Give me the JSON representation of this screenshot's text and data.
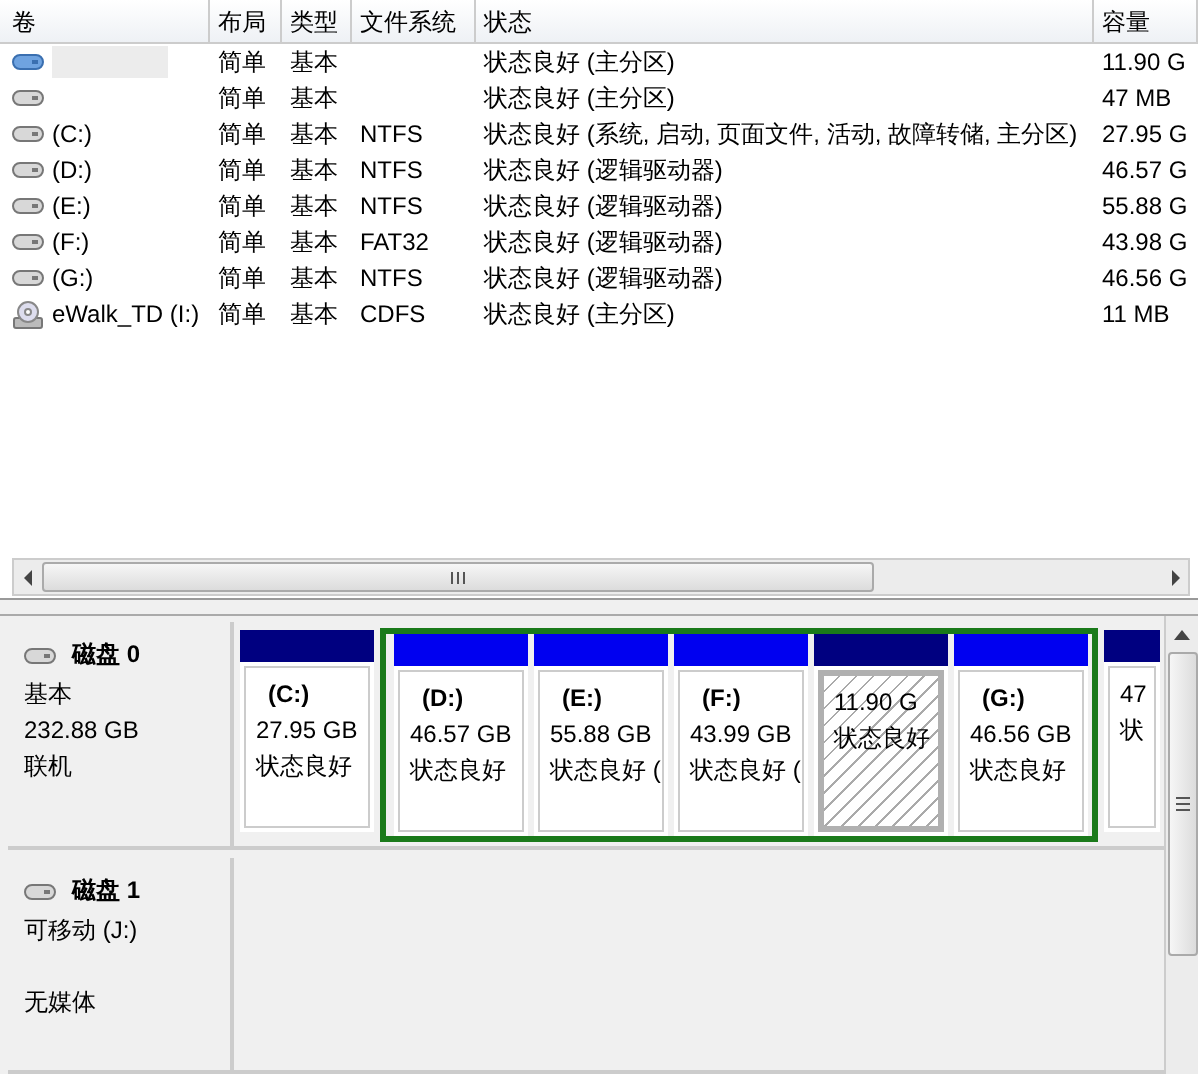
{
  "volume_list": {
    "columns": [
      "卷",
      "布局",
      "类型",
      "文件系统",
      "状态",
      "容量"
    ],
    "rows": [
      {
        "kind": "disk",
        "selected": true,
        "name_hidden": true,
        "layout": "简单",
        "type": "基本",
        "status": "状态良好 (主分区)",
        "capacity": "11.90 G"
      },
      {
        "kind": "disk",
        "selected": false,
        "layout": "简单",
        "type": "基本",
        "status": "状态良好 (主分区)",
        "capacity": "47 MB"
      },
      {
        "kind": "disk",
        "selected": false,
        "volume": "(C:)",
        "layout": "简单",
        "type": "基本",
        "filesystem": "NTFS",
        "status": "状态良好 (系统, 启动, 页面文件, 活动, 故障转储, 主分区)",
        "capacity": "27.95 G"
      },
      {
        "kind": "disk",
        "selected": false,
        "volume": "(D:)",
        "layout": "简单",
        "type": "基本",
        "filesystem": "NTFS",
        "status": "状态良好 (逻辑驱动器)",
        "capacity": "46.57 G"
      },
      {
        "kind": "disk",
        "selected": false,
        "volume": "(E:)",
        "layout": "简单",
        "type": "基本",
        "filesystem": "NTFS",
        "status": "状态良好 (逻辑驱动器)",
        "capacity": "55.88 G"
      },
      {
        "kind": "disk",
        "selected": false,
        "volume": "(F:)",
        "layout": "简单",
        "type": "基本",
        "filesystem": "FAT32",
        "status": "状态良好 (逻辑驱动器)",
        "capacity": "43.98 G"
      },
      {
        "kind": "disk",
        "selected": false,
        "volume": "(G:)",
        "layout": "简单",
        "type": "基本",
        "filesystem": "NTFS",
        "status": "状态良好 (逻辑驱动器)",
        "capacity": "46.56 G"
      },
      {
        "kind": "cdrom",
        "selected": false,
        "volume": "eWalk_TD (I:)",
        "layout": "简单",
        "type": "基本",
        "filesystem": "CDFS",
        "status": "状态良好 (主分区)",
        "capacity": "11 MB"
      }
    ]
  },
  "disks": [
    {
      "name": "磁盘 0",
      "type": "基本",
      "size": "232.88 GB",
      "state": "联机",
      "partitions": [
        {
          "kind": "primary",
          "selected": false,
          "label": "(C:)",
          "size": "27.95 GB",
          "status": "状态良好"
        },
        {
          "kind": "logical",
          "selected": false,
          "label": "(D:)",
          "size": "46.57 GB",
          "status": "状态良好"
        },
        {
          "kind": "logical",
          "selected": false,
          "label": "(E:)",
          "size": "55.88 GB",
          "status": "状态良好 ("
        },
        {
          "kind": "logical",
          "selected": false,
          "label": "(F:)",
          "size": "43.99 GB",
          "status": "状态良好 ("
        },
        {
          "kind": "primary",
          "selected": true,
          "size": "11.90 G",
          "status": "状态良好"
        },
        {
          "kind": "logical",
          "selected": false,
          "label": "(G:)",
          "size": "46.56 GB",
          "status": "状态良好"
        },
        {
          "kind": "primary",
          "selected": false,
          "size": "47",
          "status": "状"
        }
      ]
    },
    {
      "name": "磁盘 1",
      "type": "可移动 (J:)",
      "state": "无媒体"
    }
  ]
}
